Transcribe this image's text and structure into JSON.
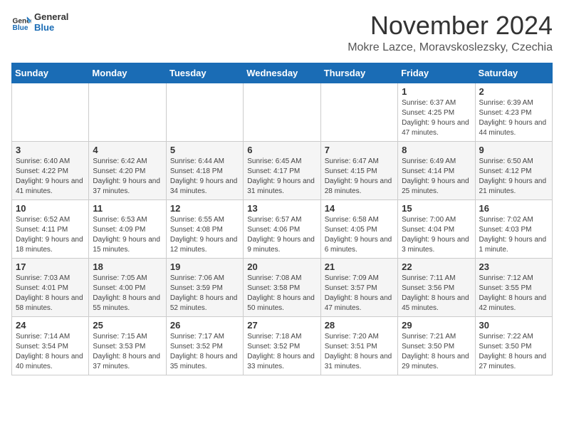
{
  "logo": {
    "general": "General",
    "blue": "Blue"
  },
  "title": "November 2024",
  "subtitle": "Mokre Lazce, Moravskoslezsky, Czechia",
  "headers": [
    "Sunday",
    "Monday",
    "Tuesday",
    "Wednesday",
    "Thursday",
    "Friday",
    "Saturday"
  ],
  "weeks": [
    [
      {
        "day": "",
        "info": ""
      },
      {
        "day": "",
        "info": ""
      },
      {
        "day": "",
        "info": ""
      },
      {
        "day": "",
        "info": ""
      },
      {
        "day": "",
        "info": ""
      },
      {
        "day": "1",
        "info": "Sunrise: 6:37 AM\nSunset: 4:25 PM\nDaylight: 9 hours and 47 minutes."
      },
      {
        "day": "2",
        "info": "Sunrise: 6:39 AM\nSunset: 4:23 PM\nDaylight: 9 hours and 44 minutes."
      }
    ],
    [
      {
        "day": "3",
        "info": "Sunrise: 6:40 AM\nSunset: 4:22 PM\nDaylight: 9 hours and 41 minutes."
      },
      {
        "day": "4",
        "info": "Sunrise: 6:42 AM\nSunset: 4:20 PM\nDaylight: 9 hours and 37 minutes."
      },
      {
        "day": "5",
        "info": "Sunrise: 6:44 AM\nSunset: 4:18 PM\nDaylight: 9 hours and 34 minutes."
      },
      {
        "day": "6",
        "info": "Sunrise: 6:45 AM\nSunset: 4:17 PM\nDaylight: 9 hours and 31 minutes."
      },
      {
        "day": "7",
        "info": "Sunrise: 6:47 AM\nSunset: 4:15 PM\nDaylight: 9 hours and 28 minutes."
      },
      {
        "day": "8",
        "info": "Sunrise: 6:49 AM\nSunset: 4:14 PM\nDaylight: 9 hours and 25 minutes."
      },
      {
        "day": "9",
        "info": "Sunrise: 6:50 AM\nSunset: 4:12 PM\nDaylight: 9 hours and 21 minutes."
      }
    ],
    [
      {
        "day": "10",
        "info": "Sunrise: 6:52 AM\nSunset: 4:11 PM\nDaylight: 9 hours and 18 minutes."
      },
      {
        "day": "11",
        "info": "Sunrise: 6:53 AM\nSunset: 4:09 PM\nDaylight: 9 hours and 15 minutes."
      },
      {
        "day": "12",
        "info": "Sunrise: 6:55 AM\nSunset: 4:08 PM\nDaylight: 9 hours and 12 minutes."
      },
      {
        "day": "13",
        "info": "Sunrise: 6:57 AM\nSunset: 4:06 PM\nDaylight: 9 hours and 9 minutes."
      },
      {
        "day": "14",
        "info": "Sunrise: 6:58 AM\nSunset: 4:05 PM\nDaylight: 9 hours and 6 minutes."
      },
      {
        "day": "15",
        "info": "Sunrise: 7:00 AM\nSunset: 4:04 PM\nDaylight: 9 hours and 3 minutes."
      },
      {
        "day": "16",
        "info": "Sunrise: 7:02 AM\nSunset: 4:03 PM\nDaylight: 9 hours and 1 minute."
      }
    ],
    [
      {
        "day": "17",
        "info": "Sunrise: 7:03 AM\nSunset: 4:01 PM\nDaylight: 8 hours and 58 minutes."
      },
      {
        "day": "18",
        "info": "Sunrise: 7:05 AM\nSunset: 4:00 PM\nDaylight: 8 hours and 55 minutes."
      },
      {
        "day": "19",
        "info": "Sunrise: 7:06 AM\nSunset: 3:59 PM\nDaylight: 8 hours and 52 minutes."
      },
      {
        "day": "20",
        "info": "Sunrise: 7:08 AM\nSunset: 3:58 PM\nDaylight: 8 hours and 50 minutes."
      },
      {
        "day": "21",
        "info": "Sunrise: 7:09 AM\nSunset: 3:57 PM\nDaylight: 8 hours and 47 minutes."
      },
      {
        "day": "22",
        "info": "Sunrise: 7:11 AM\nSunset: 3:56 PM\nDaylight: 8 hours and 45 minutes."
      },
      {
        "day": "23",
        "info": "Sunrise: 7:12 AM\nSunset: 3:55 PM\nDaylight: 8 hours and 42 minutes."
      }
    ],
    [
      {
        "day": "24",
        "info": "Sunrise: 7:14 AM\nSunset: 3:54 PM\nDaylight: 8 hours and 40 minutes."
      },
      {
        "day": "25",
        "info": "Sunrise: 7:15 AM\nSunset: 3:53 PM\nDaylight: 8 hours and 37 minutes."
      },
      {
        "day": "26",
        "info": "Sunrise: 7:17 AM\nSunset: 3:52 PM\nDaylight: 8 hours and 35 minutes."
      },
      {
        "day": "27",
        "info": "Sunrise: 7:18 AM\nSunset: 3:52 PM\nDaylight: 8 hours and 33 minutes."
      },
      {
        "day": "28",
        "info": "Sunrise: 7:20 AM\nSunset: 3:51 PM\nDaylight: 8 hours and 31 minutes."
      },
      {
        "day": "29",
        "info": "Sunrise: 7:21 AM\nSunset: 3:50 PM\nDaylight: 8 hours and 29 minutes."
      },
      {
        "day": "30",
        "info": "Sunrise: 7:22 AM\nSunset: 3:50 PM\nDaylight: 8 hours and 27 minutes."
      }
    ]
  ]
}
